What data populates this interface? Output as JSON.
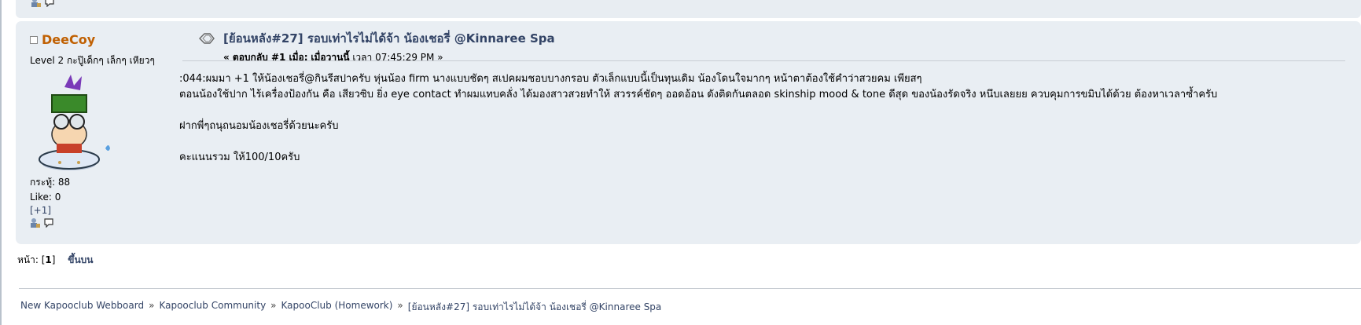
{
  "poster": {
    "name": "DeeCoy",
    "title": "Level 2 กะปู๊เด็กๆ เล็กๆ เหียวๆ",
    "posts": "กระทู้: 88",
    "likes": "Like: 0",
    "plus_one": "[+1]"
  },
  "message": {
    "subject": "[ย้อนหลัง#27] รอบเท่าไรไม่ได้จ้า น้องเชอรี่ @Kinnaree Spa",
    "reply_label": "« ตอบกลับ #1 เมื่อ:",
    "date_label": "เมื่อวานนี้",
    "time_text": "เวลา 07:45:29 PM »",
    "body": [
      ":044:ผมมา +1 ให้น้องเชอรี่@กินรีสปาครับ หุ่นน้อง firm นางแบบชัดๆ สเปคผมชอบบางกรอบ ตัวเล็กแบบนี้เป็นทุนเดิม น้องโดนใจมากๆ หน้าตาต้องใช้คำว่าสวยคม เพียสๆ",
      "ตอนน้องใช้ปาก ไร้เครื่องป้องกัน คือ เสียวซิบ ยิ่ง eye contact ทำผมแทบคลั่ง ได้มองสาวสวยทำให้ สวรรค์ชัดๆ ออดอ้อน ดังติดกันตลอด skinship mood & tone ดีสุด ของน้องรัดจริง หนึบเลยยย ควบคุมการขมิบได้ด้วย ต้องหาเวลาซ้ำครับ",
      "",
      "ฝากพี่ๆถนุถนอมน้องเชอรี่ด้วยนะครับ",
      "",
      "คะแนนรวม ให้100/10ครับ"
    ]
  },
  "pagination": {
    "label": "หน้า:",
    "current": "1",
    "top_link": "ขึ้นบน"
  },
  "linktree": [
    "New Kapooclub Webboard",
    "Kapooclub Community",
    "KapooClub (Homework)",
    "[ย้อนหลัง#27] รอบเท่าไรไม่ได้จ้า น้องเชอรี่ @Kinnaree Spa"
  ],
  "linktree_separator": "»",
  "icons": [
    "profile-icon",
    "pm-icon",
    "post-icon"
  ]
}
